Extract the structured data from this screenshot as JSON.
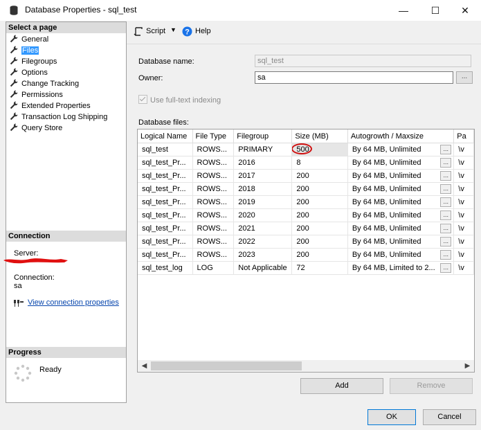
{
  "window": {
    "title": "Database Properties - sql_test",
    "minimize": "—",
    "maximize": "☐",
    "close": "✕"
  },
  "left": {
    "select_page_header": "Select a page",
    "pages": [
      {
        "label": "General",
        "selected": false
      },
      {
        "label": "Files",
        "selected": true
      },
      {
        "label": "Filegroups",
        "selected": false
      },
      {
        "label": "Options",
        "selected": false
      },
      {
        "label": "Change Tracking",
        "selected": false
      },
      {
        "label": "Permissions",
        "selected": false
      },
      {
        "label": "Extended Properties",
        "selected": false
      },
      {
        "label": "Transaction Log Shipping",
        "selected": false
      },
      {
        "label": "Query Store",
        "selected": false
      }
    ],
    "connection_header": "Connection",
    "server_label": "Server:",
    "connection_label": "Connection:",
    "connection_value": "sa",
    "view_connection_link": "View connection properties",
    "progress_header": "Progress",
    "progress_status": "Ready"
  },
  "toolbar": {
    "script_label": "Script",
    "help_label": "Help"
  },
  "form": {
    "database_name_label": "Database name:",
    "database_name_value": "sql_test",
    "owner_label": "Owner:",
    "owner_value": "sa",
    "browse_button": "...",
    "fulltext_label": "Use full-text indexing",
    "fulltext_checked": true,
    "database_files_label": "Database files:"
  },
  "grid": {
    "columns": [
      "Logical Name",
      "File Type",
      "Filegroup",
      "Size (MB)",
      "Autogrowth / Maxsize",
      "Pa"
    ],
    "rows": [
      {
        "name": "sql_test",
        "type": "ROWS...",
        "filegroup": "PRIMARY",
        "size": "500",
        "autogrowth": "By 64 MB, Unlimited",
        "path": "\\v"
      },
      {
        "name": "sql_test_Pr...",
        "type": "ROWS...",
        "filegroup": "2016",
        "size": "8",
        "autogrowth": "By 64 MB, Unlimited",
        "path": "\\v"
      },
      {
        "name": "sql_test_Pr...",
        "type": "ROWS...",
        "filegroup": "2017",
        "size": "200",
        "autogrowth": "By 64 MB, Unlimited",
        "path": "\\v"
      },
      {
        "name": "sql_test_Pr...",
        "type": "ROWS...",
        "filegroup": "2018",
        "size": "200",
        "autogrowth": "By 64 MB, Unlimited",
        "path": "\\v"
      },
      {
        "name": "sql_test_Pr...",
        "type": "ROWS...",
        "filegroup": "2019",
        "size": "200",
        "autogrowth": "By 64 MB, Unlimited",
        "path": "\\v"
      },
      {
        "name": "sql_test_Pr...",
        "type": "ROWS...",
        "filegroup": "2020",
        "size": "200",
        "autogrowth": "By 64 MB, Unlimited",
        "path": "\\v"
      },
      {
        "name": "sql_test_Pr...",
        "type": "ROWS...",
        "filegroup": "2021",
        "size": "200",
        "autogrowth": "By 64 MB, Unlimited",
        "path": "\\v"
      },
      {
        "name": "sql_test_Pr...",
        "type": "ROWS...",
        "filegroup": "2022",
        "size": "200",
        "autogrowth": "By 64 MB, Unlimited",
        "path": "\\v"
      },
      {
        "name": "sql_test_Pr...",
        "type": "ROWS...",
        "filegroup": "2023",
        "size": "200",
        "autogrowth": "By 64 MB, Unlimited",
        "path": "\\v"
      },
      {
        "name": "sql_test_log",
        "type": "LOG",
        "filegroup": "Not Applicable",
        "size": "72",
        "autogrowth": "By 64 MB, Limited to 2...",
        "path": "\\v"
      }
    ],
    "cell_button": "..."
  },
  "buttons": {
    "add": "Add",
    "remove": "Remove",
    "ok": "OK",
    "cancel": "Cancel"
  },
  "colors": {
    "selection": "#3399ff",
    "highlight_circle": "#d01010",
    "link": "#0645ad"
  }
}
